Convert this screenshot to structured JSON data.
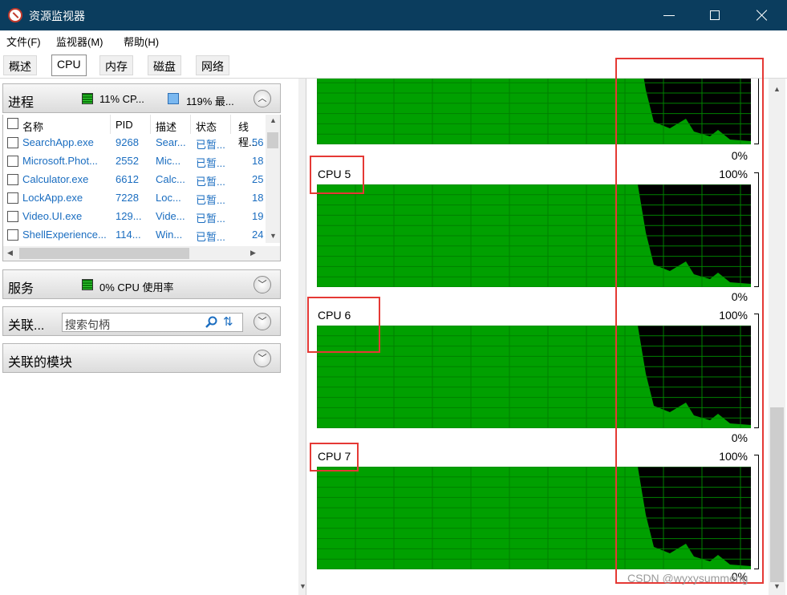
{
  "window": {
    "title": "资源监视器"
  },
  "menu": [
    "文件(F)",
    "监视器(M)",
    "帮助(H)"
  ],
  "tabs": [
    "概述",
    "CPU",
    "内存",
    "磁盘",
    "网络"
  ],
  "active_tab": "CPU",
  "processes": {
    "title": "进程",
    "cpu_legend": "11% CP...",
    "max_legend": "119% 最...",
    "columns": [
      "名称",
      "PID",
      "描述",
      "状态",
      "线程..."
    ],
    "rows": [
      {
        "name": "SearchApp.exe",
        "pid": "9268",
        "desc": "Sear...",
        "status": "已暂...",
        "threads": "56"
      },
      {
        "name": "Microsoft.Phot...",
        "pid": "2552",
        "desc": "Mic...",
        "status": "已暂...",
        "threads": "18"
      },
      {
        "name": "Calculator.exe",
        "pid": "6612",
        "desc": "Calc...",
        "status": "已暂...",
        "threads": "25"
      },
      {
        "name": "LockApp.exe",
        "pid": "7228",
        "desc": "Loc...",
        "status": "已暂...",
        "threads": "18"
      },
      {
        "name": "Video.UI.exe",
        "pid": "129...",
        "desc": "Vide...",
        "status": "已暂...",
        "threads": "19"
      },
      {
        "name": "ShellExperience...",
        "pid": "114...",
        "desc": "Win...",
        "status": "已暂...",
        "threads": "24"
      }
    ]
  },
  "services": {
    "title": "服务",
    "cpu_legend": "0% CPU 使用率"
  },
  "handles": {
    "title": "关联...",
    "search_placeholder": "搜索句柄"
  },
  "modules": {
    "title": "关联的模块"
  },
  "graphs": {
    "pct_top": "100%",
    "pct_bottom": "0%",
    "cpus": [
      {
        "label": "CPU 5"
      },
      {
        "label": "CPU 6"
      },
      {
        "label": "CPU 7"
      }
    ]
  },
  "watermark": "CSDN @wyxysummeng",
  "colors": {
    "titlebar": "#0b3d5e",
    "graph_fill": "#00a000",
    "graph_grid": "#008000",
    "highlight": "#e53935"
  }
}
